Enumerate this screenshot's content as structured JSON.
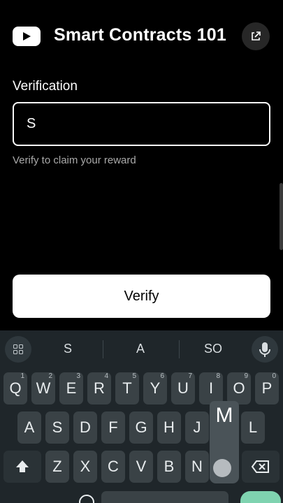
{
  "header": {
    "title": "Smart Contracts 101",
    "logo_icon": "youtube-logo-icon",
    "external_icon": "external-link-icon"
  },
  "form": {
    "label": "Verification",
    "input_value": "S",
    "helper": "Verify to claim your reward",
    "button_label": "Verify"
  },
  "keyboard": {
    "suggestions": [
      "S",
      "A",
      "SO"
    ],
    "row1": [
      {
        "k": "Q",
        "h": "1"
      },
      {
        "k": "W",
        "h": "2"
      },
      {
        "k": "E",
        "h": "3"
      },
      {
        "k": "R",
        "h": "4"
      },
      {
        "k": "T",
        "h": "5"
      },
      {
        "k": "Y",
        "h": "6"
      },
      {
        "k": "U",
        "h": "7"
      },
      {
        "k": "I",
        "h": "8"
      },
      {
        "k": "O",
        "h": "9"
      },
      {
        "k": "P",
        "h": "0"
      }
    ],
    "row2": [
      "A",
      "S",
      "D",
      "F",
      "G",
      "H",
      "J",
      "M",
      "L"
    ],
    "row3": [
      "Z",
      "X",
      "C",
      "V",
      "B",
      "N"
    ],
    "popup_key": "M"
  }
}
